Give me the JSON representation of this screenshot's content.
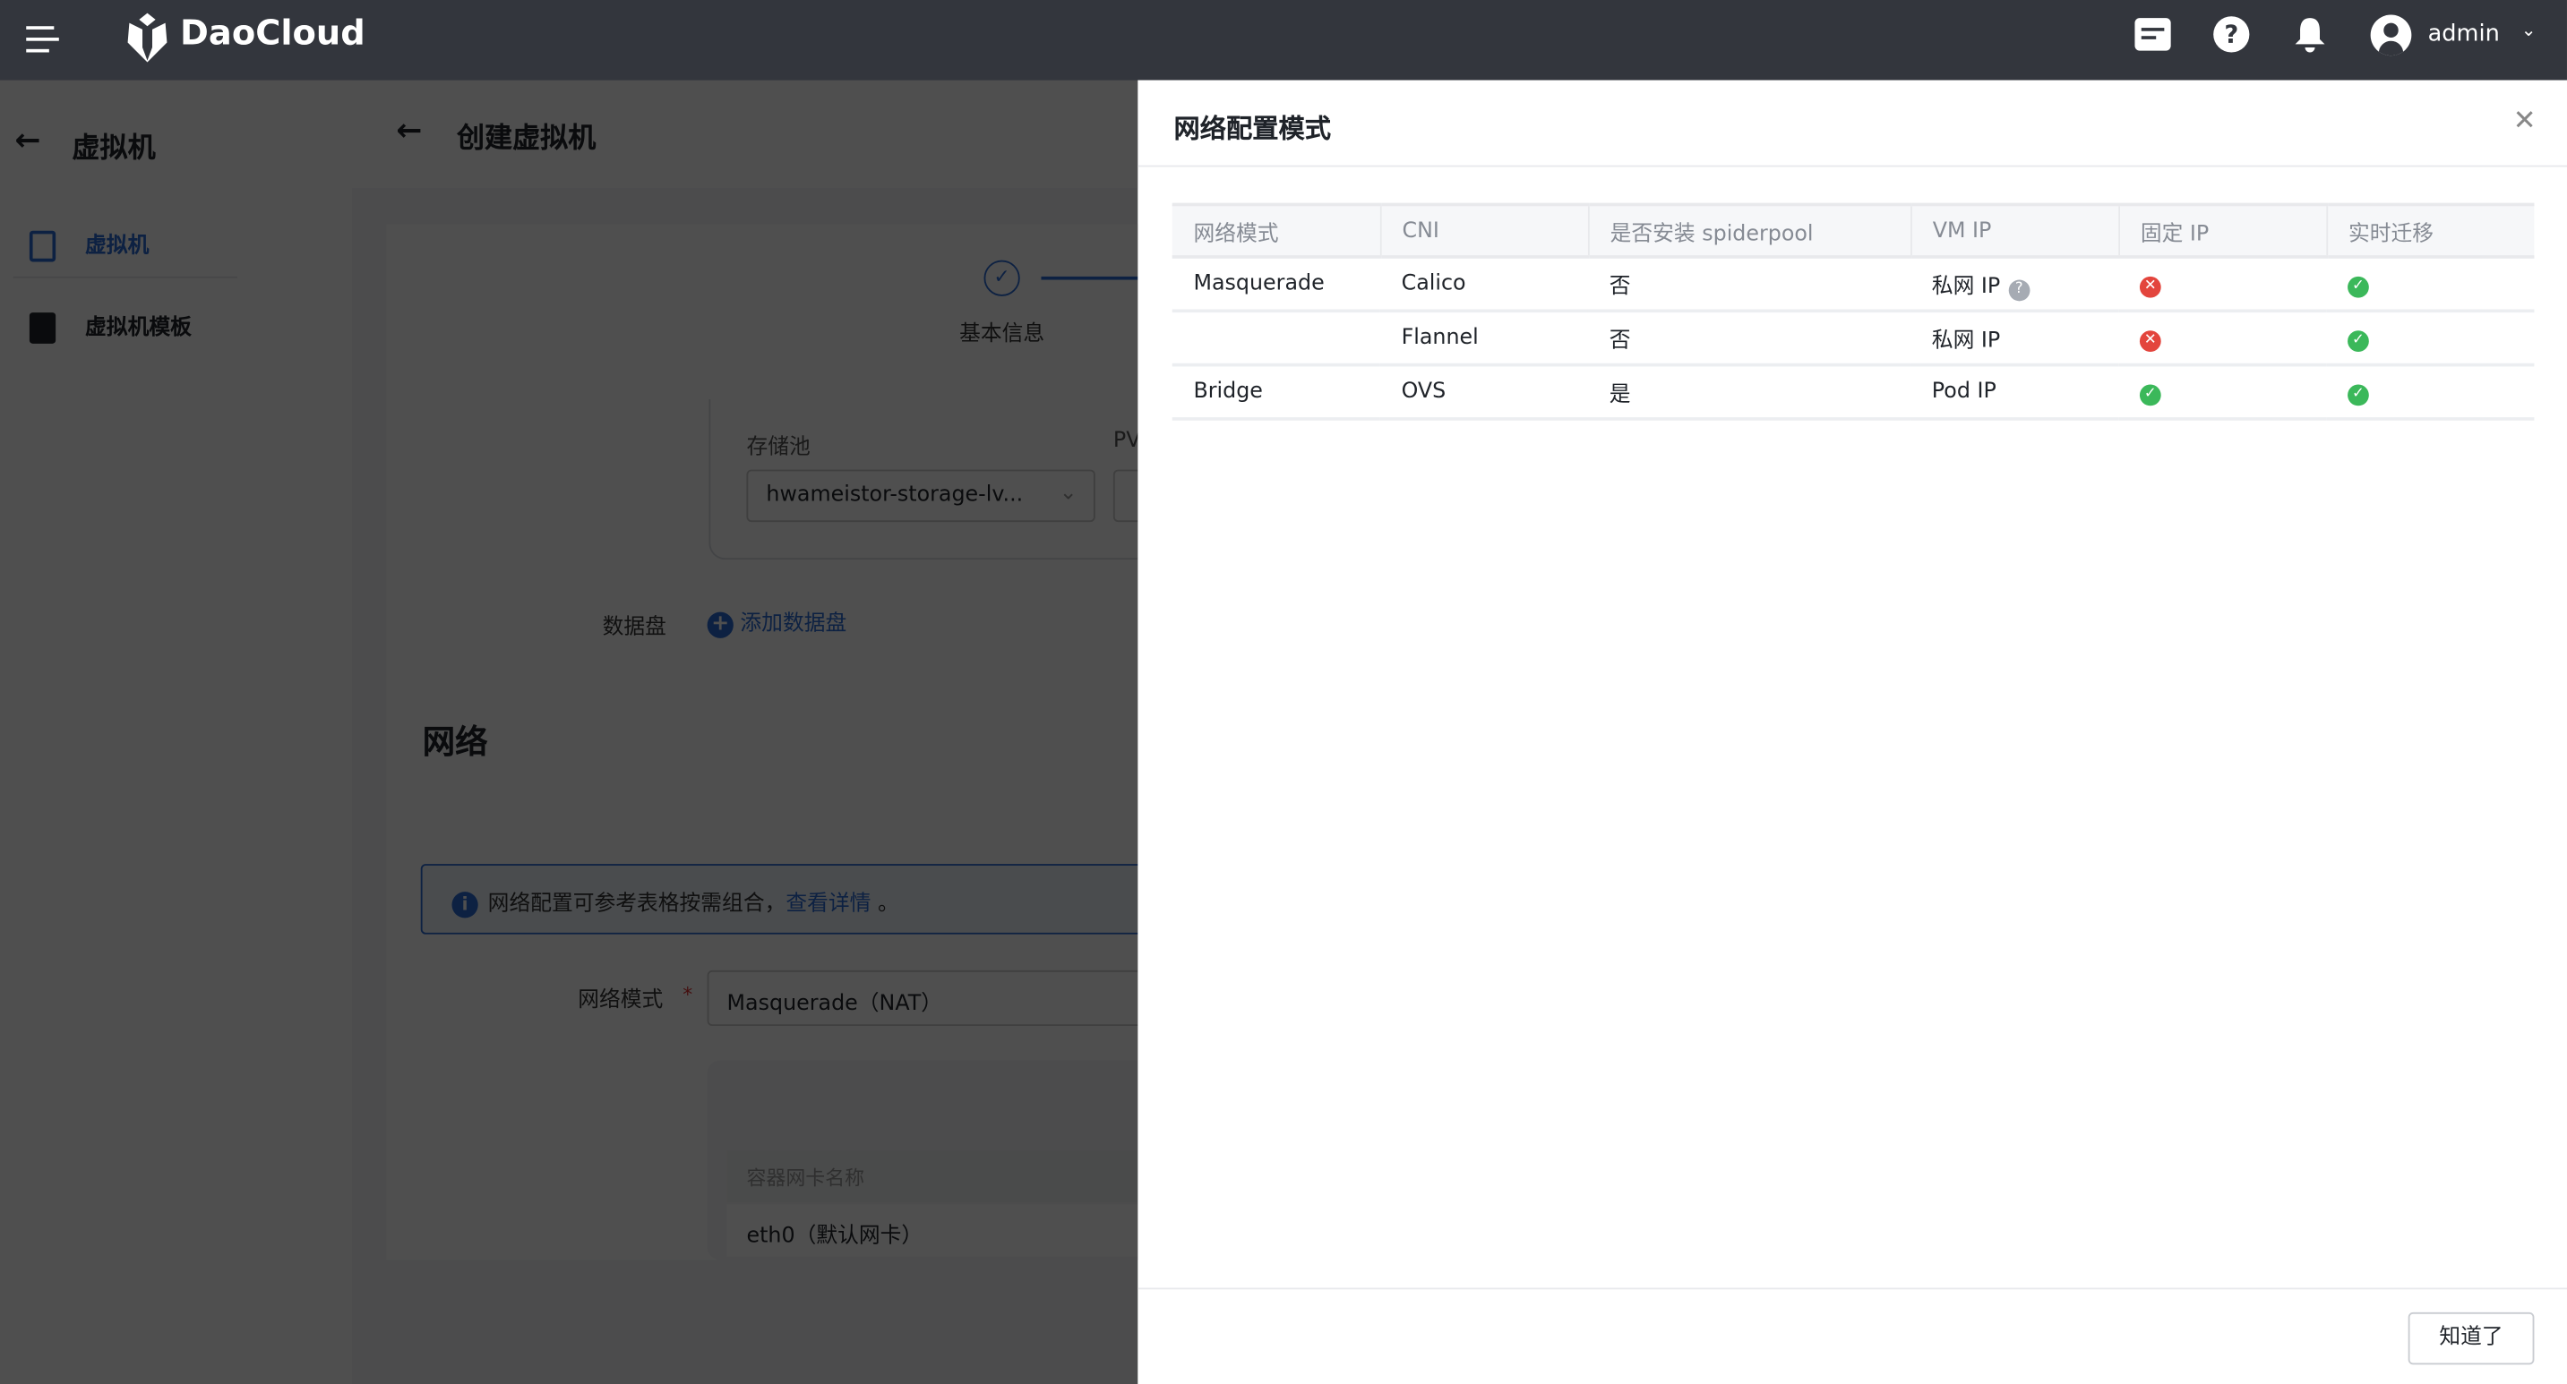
{
  "header": {
    "brand": "DaoCloud",
    "user": "admin"
  },
  "sidebar": {
    "back_title": "虚拟机",
    "items": [
      {
        "label": "虚拟机"
      },
      {
        "label": "虚拟机模板"
      }
    ]
  },
  "page": {
    "title": "创建虚拟机",
    "step_label": "基本信息",
    "storage_pool_label": "存储池",
    "storage_pool_value": "hwameistor-storage-lv...",
    "pv_label": "PV",
    "data_disk_label": "数据盘",
    "add_data_disk": "添加数据盘",
    "network_title": "网络",
    "info_text": "网络配置可参考表格按需组合，",
    "info_link": "查看详情",
    "info_end": "。",
    "network_mode_label": "网络模式",
    "network_mode_value": "Masquerade（NAT）",
    "nic_header": "容器网卡名称",
    "nic_value": "eth0（默认网卡）"
  },
  "drawer": {
    "title": "网络配置模式",
    "columns": [
      "网络模式",
      "CNI",
      "是否安装 spiderpool",
      "VM IP",
      "固定 IP",
      "实时迁移"
    ],
    "rows": [
      {
        "mode": "Masquerade",
        "cni": "Calico",
        "spiderpool": "否",
        "vm_ip": "私网 IP",
        "vm_ip_help": true,
        "fixed_ip": false,
        "live_migration": true
      },
      {
        "mode": "",
        "cni": "Flannel",
        "spiderpool": "否",
        "vm_ip": "私网 IP",
        "vm_ip_help": false,
        "fixed_ip": false,
        "live_migration": true
      },
      {
        "mode": "Bridge",
        "cni": "OVS",
        "spiderpool": "是",
        "vm_ip": "Pod IP",
        "vm_ip_help": false,
        "fixed_ip": true,
        "live_migration": true
      }
    ],
    "ok_button": "知道了"
  },
  "colors": {
    "header_bg": "#33363d",
    "accent": "#2a6bd6",
    "success": "#3bb85a",
    "error": "#e3453d"
  }
}
